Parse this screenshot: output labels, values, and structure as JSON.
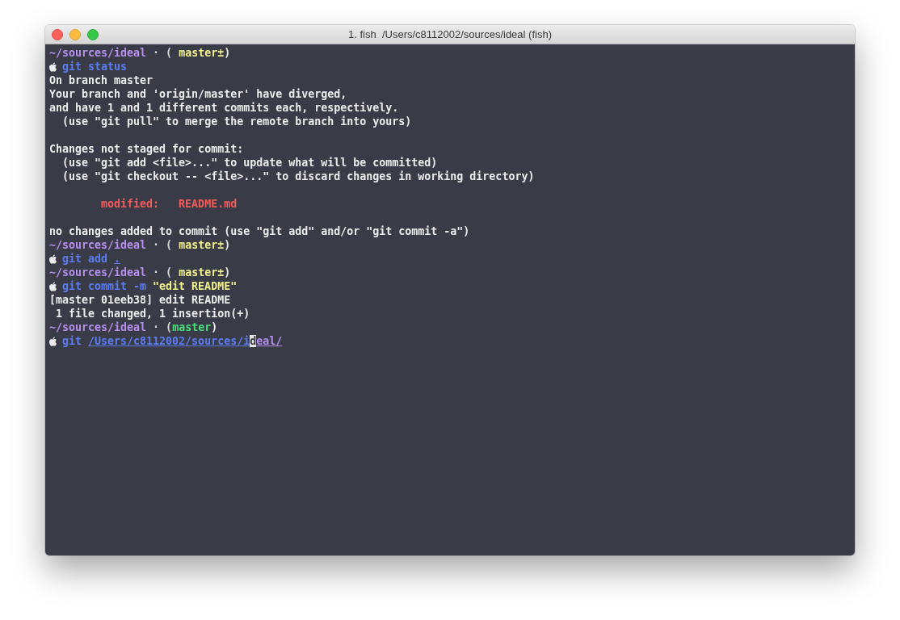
{
  "window": {
    "title": "1. fish  /Users/c8112002/sources/ideal (fish)"
  },
  "lines": [
    {
      "kind": "status",
      "segments": [
        {
          "text": "~/sources/ideal",
          "kind": "path"
        },
        {
          "text": " · ( ",
          "kind": "muted"
        },
        {
          "text": "master±",
          "kind": "dirty"
        },
        {
          "text": ")",
          "kind": "plain"
        }
      ]
    },
    {
      "kind": "prompt",
      "segments": [
        {
          "text": "git status",
          "kind": "command"
        }
      ]
    },
    {
      "kind": "output",
      "segments": [
        {
          "text": "On branch master",
          "kind": "plain"
        }
      ]
    },
    {
      "kind": "output",
      "segments": [
        {
          "text": "Your branch and 'origin/master' have diverged,",
          "kind": "plain"
        }
      ]
    },
    {
      "kind": "output",
      "segments": [
        {
          "text": "and have 1 and 1 different commits each, respectively.",
          "kind": "plain"
        }
      ]
    },
    {
      "kind": "output",
      "segments": [
        {
          "text": "  (use \"git pull\" to merge the remote branch into yours)",
          "kind": "plain"
        }
      ]
    },
    {
      "kind": "blank"
    },
    {
      "kind": "output",
      "segments": [
        {
          "text": "Changes not staged for commit:",
          "kind": "plain"
        }
      ]
    },
    {
      "kind": "output",
      "segments": [
        {
          "text": "  (use \"git add <file>...\" to update what will be committed)",
          "kind": "plain"
        }
      ]
    },
    {
      "kind": "output",
      "segments": [
        {
          "text": "  (use \"git checkout -- <file>...\" to discard changes in working directory)",
          "kind": "plain"
        }
      ]
    },
    {
      "kind": "blank"
    },
    {
      "kind": "output",
      "segments": [
        {
          "text": "        modified:   README.md",
          "kind": "error"
        }
      ]
    },
    {
      "kind": "blank"
    },
    {
      "kind": "output",
      "segments": [
        {
          "text": "no changes added to commit (use \"git add\" and/or \"git commit -a\")",
          "kind": "plain"
        }
      ]
    },
    {
      "kind": "status",
      "segments": [
        {
          "text": "~/sources/ideal",
          "kind": "path"
        },
        {
          "text": " · ( ",
          "kind": "muted"
        },
        {
          "text": "master±",
          "kind": "dirty"
        },
        {
          "text": ")",
          "kind": "plain"
        }
      ]
    },
    {
      "kind": "prompt",
      "segments": [
        {
          "text": "git add ",
          "kind": "command"
        },
        {
          "text": ".",
          "kind": "link"
        }
      ]
    },
    {
      "kind": "status",
      "segments": [
        {
          "text": "~/sources/ideal",
          "kind": "path"
        },
        {
          "text": " · ( ",
          "kind": "muted"
        },
        {
          "text": "master±",
          "kind": "dirty"
        },
        {
          "text": ")",
          "kind": "plain"
        }
      ]
    },
    {
      "kind": "prompt",
      "segments": [
        {
          "text": "git commit -m ",
          "kind": "command"
        },
        {
          "text": "\"edit README\"",
          "kind": "string"
        }
      ]
    },
    {
      "kind": "output",
      "segments": [
        {
          "text": "[master 01eeb38] edit README",
          "kind": "plain"
        }
      ]
    },
    {
      "kind": "output",
      "segments": [
        {
          "text": " 1 file changed, 1 insertion(+)",
          "kind": "plain"
        }
      ]
    },
    {
      "kind": "status",
      "segments": [
        {
          "text": "~/sources/ideal",
          "kind": "path"
        },
        {
          "text": " · (",
          "kind": "muted"
        },
        {
          "text": "master",
          "kind": "clean"
        },
        {
          "text": ")",
          "kind": "plain"
        }
      ]
    },
    {
      "kind": "prompt",
      "segments": [
        {
          "text": "git ",
          "kind": "command"
        },
        {
          "text": "/Users/c8112002/sources/i",
          "kind": "link"
        },
        {
          "text": "d",
          "kind": "cursor"
        },
        {
          "text": "eal/",
          "kind": "link-path"
        }
      ]
    }
  ]
}
